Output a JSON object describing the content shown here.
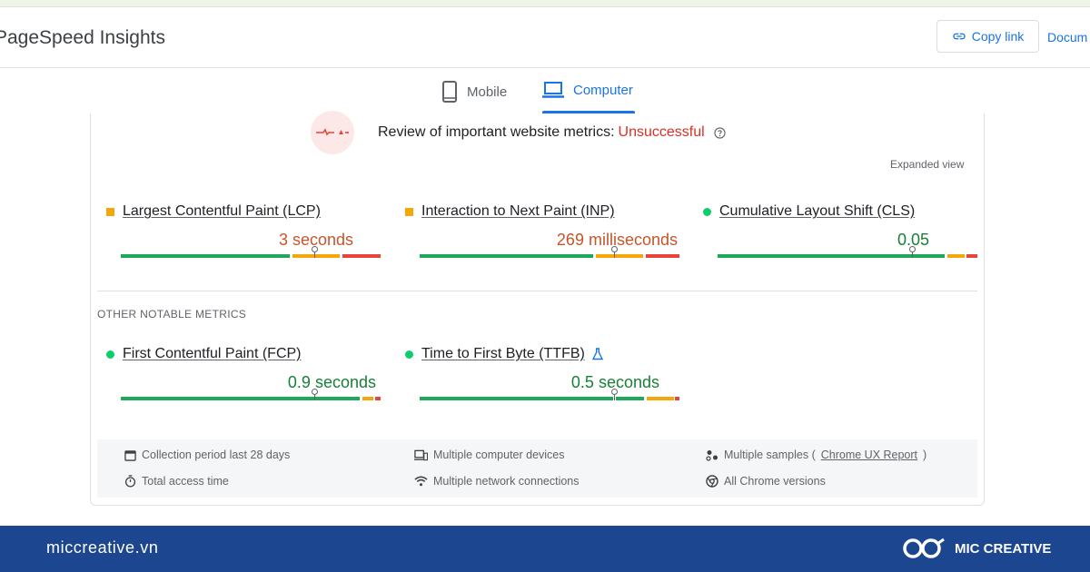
{
  "header": {
    "app_title": "PageSpeed Insights",
    "copy_link_label": "Copy link",
    "docs_label": "Docum"
  },
  "tabs": [
    {
      "label": "Mobile",
      "icon": "smartphone-icon",
      "selected": false
    },
    {
      "label": "Computer",
      "icon": "laptop-icon",
      "selected": true
    }
  ],
  "assessment": {
    "text": "Review of important website metrics:",
    "status": "Unsuccessful",
    "expanded_label": "Expanded view"
  },
  "core_metrics": [
    {
      "label": "Largest Contentful Paint (LCP)",
      "value": "3 seconds",
      "rating": "needs-improvement",
      "marker": "square"
    },
    {
      "label": "Interaction to Next Paint (INP)",
      "value": "269 milliseconds",
      "rating": "needs-improvement",
      "marker": "square"
    },
    {
      "label": "Cumulative Layout Shift (CLS)",
      "value": "0.05",
      "rating": "good",
      "marker": "circle"
    }
  ],
  "other_metrics": {
    "title": "OTHER NOTABLE METRICS",
    "items": [
      {
        "label": "First Contentful Paint (FCP)",
        "value": "0.9 seconds",
        "rating": "good",
        "marker": "circle"
      },
      {
        "label": "Time to First Byte (TTFB)",
        "value": "0.5 seconds",
        "rating": "good",
        "marker": "circle",
        "icon": "flask-icon"
      }
    ]
  },
  "info": {
    "collection_period": "Collection period last 28 days",
    "devices": "Multiple computer devices",
    "samples_prefix": "Multiple samples (",
    "samples_link": "Chrome UX Report",
    "samples_suffix": ")",
    "duration": "Total access time",
    "network": "Multiple network connections",
    "chrome_versions": "All Chrome versions"
  },
  "footer": {
    "site": "miccreative.vn",
    "brand": "MIC CREATIVE"
  },
  "colors": {
    "accent": "#1a73e8",
    "fail": "#d93025",
    "average": "#f4a70a",
    "good": "#0cce6b",
    "poor": "#e8443a",
    "footer_bg": "#1d4690"
  }
}
